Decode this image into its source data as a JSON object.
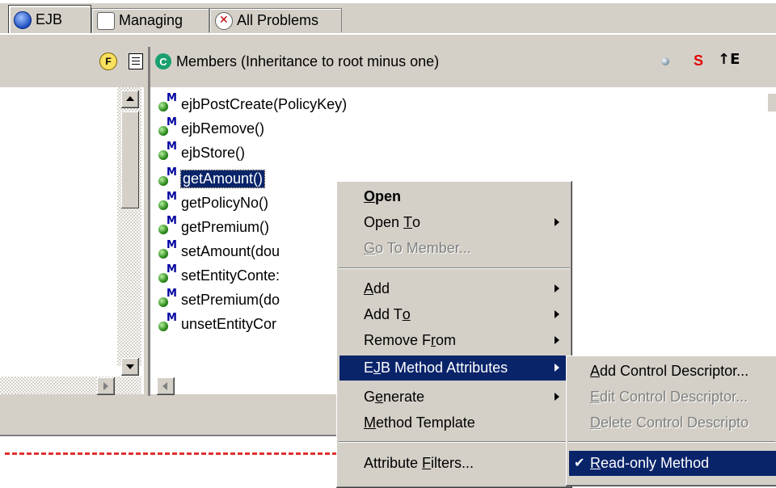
{
  "tabs": [
    {
      "label": "EJB",
      "icon": "ejb-icon",
      "active": true
    },
    {
      "label": "Managing",
      "icon": "managing-icon",
      "active": false
    },
    {
      "label": "All Problems",
      "icon": "problems-icon",
      "active": false
    }
  ],
  "members_header": {
    "icon": "class-c-icon",
    "title": "Members (Inheritance to root minus one)",
    "toolbar_icons": [
      "dot-icon",
      "s-filter-icon",
      "sort-hierarchy-icon"
    ]
  },
  "left_toolbar_icons": [
    "f-filter-icon",
    "list-icon"
  ],
  "members": [
    {
      "label": "ejbPostCreate(PolicyKey)",
      "selected": false
    },
    {
      "label": "ejbRemove()",
      "selected": false
    },
    {
      "label": "ejbStore()",
      "selected": false
    },
    {
      "label": "getAmount()",
      "selected": true
    },
    {
      "label": "getPolicyNo()",
      "selected": false
    },
    {
      "label": "getPremium()",
      "selected": false
    },
    {
      "label": "setAmount(dou",
      "selected": false
    },
    {
      "label": "setEntityConte:",
      "selected": false
    },
    {
      "label": "setPremium(do",
      "selected": false
    },
    {
      "label": "unsetEntityCor",
      "selected": false
    }
  ],
  "context_menu": {
    "items": [
      {
        "pre": "",
        "key": "O",
        "post": "pen",
        "bold": true,
        "enabled": true,
        "submenu": false
      },
      {
        "pre": "Open ",
        "key": "T",
        "post": "o",
        "enabled": true,
        "submenu": true
      },
      {
        "pre": "",
        "key": "G",
        "post": "o To Member...",
        "enabled": false,
        "submenu": false
      },
      {
        "pre": "",
        "key": "A",
        "post": "dd",
        "enabled": true,
        "submenu": true
      },
      {
        "pre": "Add T",
        "key": "o",
        "post": "",
        "enabled": true,
        "submenu": true
      },
      {
        "pre": "Remove F",
        "key": "r",
        "post": "om",
        "enabled": true,
        "submenu": true
      },
      {
        "pre": "E",
        "key": "J",
        "post": "B Method Attributes",
        "enabled": true,
        "submenu": true,
        "highlighted": true
      },
      {
        "pre": "G",
        "key": "e",
        "post": "nerate",
        "enabled": true,
        "submenu": true
      },
      {
        "pre": "",
        "key": "M",
        "post": "ethod Template",
        "enabled": true,
        "submenu": false
      },
      {
        "pre": "Attribute ",
        "key": "F",
        "post": "ilters...",
        "enabled": true,
        "submenu": false
      }
    ]
  },
  "submenu": {
    "items": [
      {
        "pre": "",
        "key": "A",
        "post": "dd Control Descriptor...",
        "enabled": true
      },
      {
        "pre": "",
        "key": "E",
        "post": "dit Control Descriptor...",
        "enabled": false
      },
      {
        "pre": "",
        "key": "D",
        "post": "elete Control Descripto",
        "enabled": false
      },
      {
        "pre": "",
        "key": "R",
        "post": "ead-only Method",
        "enabled": true,
        "checked": true,
        "highlighted": true
      }
    ]
  },
  "colors": {
    "face": "#d4d0c8",
    "highlight": "#0a246a",
    "dashed_line": "#e03030"
  }
}
